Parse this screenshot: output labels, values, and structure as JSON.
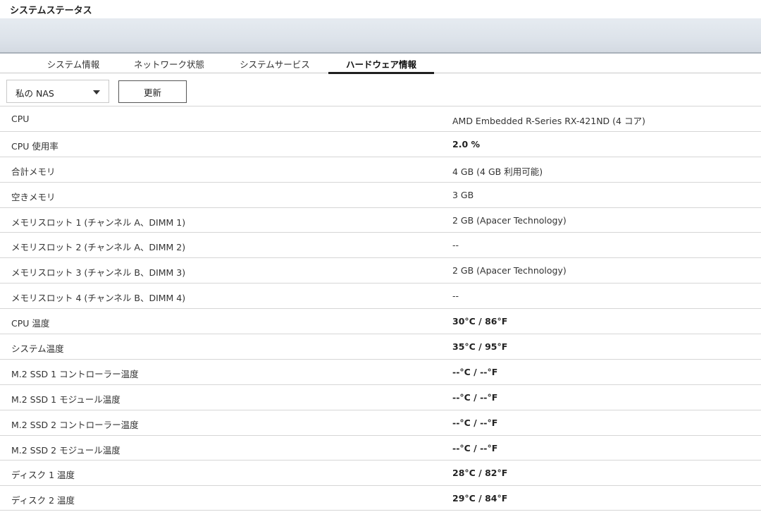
{
  "window": {
    "title": "システムステータス"
  },
  "tabs": [
    {
      "label": "システム情報",
      "active": false
    },
    {
      "label": "ネットワーク状態",
      "active": false
    },
    {
      "label": "システムサービス",
      "active": false
    },
    {
      "label": "ハードウェア情報",
      "active": true
    }
  ],
  "toolbar": {
    "device_select_value": "私の NAS",
    "refresh_label": "更新"
  },
  "hardware_rows": [
    {
      "label": "CPU",
      "value": "AMD Embedded R-Series RX-421ND (4 コア)",
      "emphasis": false
    },
    {
      "label": "CPU 使用率",
      "value": "2.0 %",
      "emphasis": true
    },
    {
      "label": "合計メモリ",
      "value": "4 GB (4 GB 利用可能)",
      "emphasis": false
    },
    {
      "label": "空きメモリ",
      "value": "3 GB",
      "emphasis": false
    },
    {
      "label": "メモリスロット 1 (チャンネル A、DIMM 1)",
      "value": "2 GB (Apacer Technology)",
      "emphasis": false
    },
    {
      "label": "メモリスロット 2 (チャンネル A、DIMM 2)",
      "value": "--",
      "emphasis": false
    },
    {
      "label": "メモリスロット 3 (チャンネル B、DIMM 3)",
      "value": "2 GB (Apacer Technology)",
      "emphasis": false
    },
    {
      "label": "メモリスロット 4 (チャンネル B、DIMM 4)",
      "value": "--",
      "emphasis": false
    },
    {
      "label": "CPU 温度",
      "value": "30°C / 86°F",
      "emphasis": true
    },
    {
      "label": "システム温度",
      "value": "35°C / 95°F",
      "emphasis": true
    },
    {
      "label": "M.2 SSD 1 コントローラー温度",
      "value": "--°C / --°F",
      "emphasis": true
    },
    {
      "label": "M.2 SSD 1 モジュール温度",
      "value": "--°C / --°F",
      "emphasis": true
    },
    {
      "label": "M.2 SSD 2 コントローラー温度",
      "value": "--°C / --°F",
      "emphasis": true
    },
    {
      "label": "M.2 SSD 2 モジュール温度",
      "value": "--°C / --°F",
      "emphasis": true
    },
    {
      "label": "ディスク 1 温度",
      "value": "28°C / 82°F",
      "emphasis": true
    },
    {
      "label": "ディスク 2 温度",
      "value": "29°C / 84°F",
      "emphasis": true
    }
  ]
}
